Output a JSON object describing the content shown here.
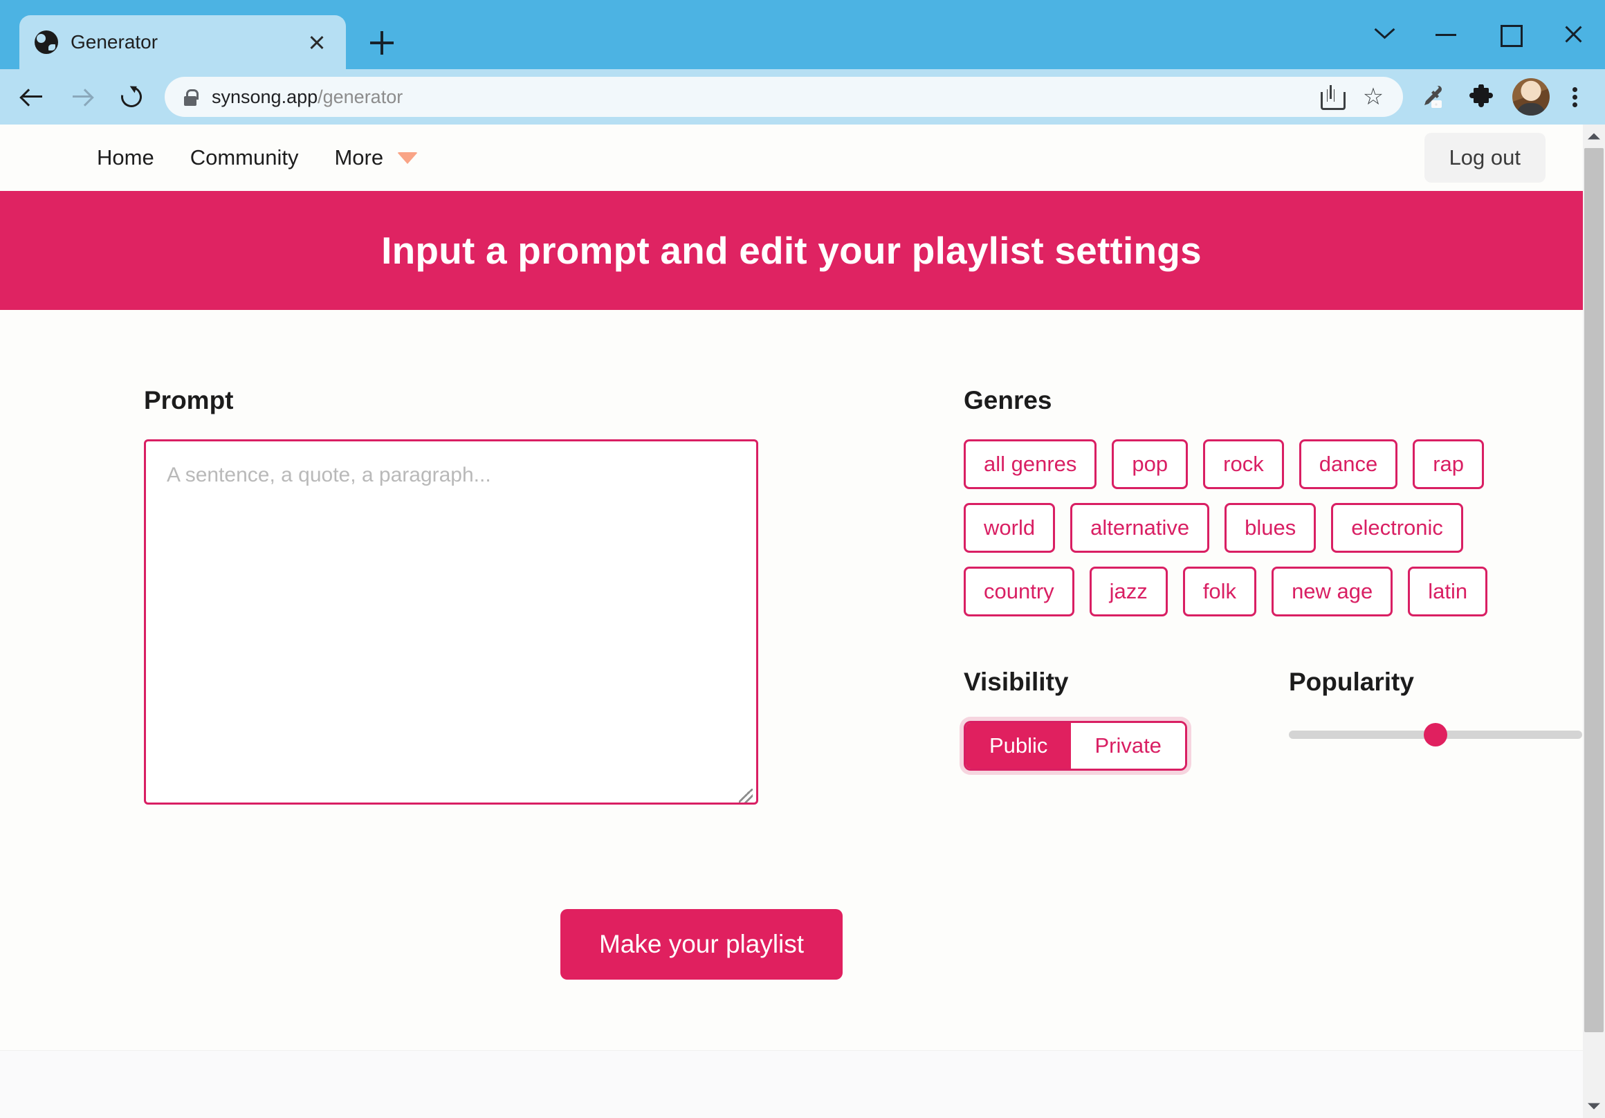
{
  "browser": {
    "tab": {
      "title": "Generator",
      "favicon": "globe-icon"
    },
    "new_tab_label": "+",
    "window_controls": [
      "chevron-down-icon",
      "minimize-icon",
      "maximize-icon",
      "close-icon"
    ],
    "nav": {
      "back": "back-arrow-icon",
      "forward": "forward-arrow-icon",
      "reload": "reload-icon"
    },
    "omnibox": {
      "lock": "lock-icon",
      "url_domain": "synsong.app",
      "url_path": "/generator",
      "url_full": "synsong.app/generator",
      "share": "share-icon",
      "bookmark": "star-icon"
    },
    "toolbar_icons": [
      "eyedropper-icon",
      "extensions-puzzle-icon",
      "avatar",
      "kebab-menu-icon"
    ]
  },
  "site_header": {
    "nav_items": [
      {
        "label": "Home"
      },
      {
        "label": "Community"
      },
      {
        "label": "More"
      }
    ],
    "more_chevron": "chevron-down-icon",
    "logout_label": "Log out"
  },
  "hero": {
    "title": "Input a prompt and edit your playlist settings",
    "bg_color": "#df2362"
  },
  "prompt": {
    "label": "Prompt",
    "value": "",
    "placeholder": "A sentence, a quote, a paragraph..."
  },
  "genres": {
    "label": "Genres",
    "rows": [
      [
        {
          "label": "all genres",
          "selected": false
        },
        {
          "label": "pop",
          "selected": false
        },
        {
          "label": "rock",
          "selected": false
        },
        {
          "label": "dance",
          "selected": false
        },
        {
          "label": "rap",
          "selected": false
        }
      ],
      [
        {
          "label": "world",
          "selected": false
        },
        {
          "label": "alternative",
          "selected": false
        },
        {
          "label": "blues",
          "selected": false
        },
        {
          "label": "electronic",
          "selected": false
        }
      ],
      [
        {
          "label": "country",
          "selected": false
        },
        {
          "label": "jazz",
          "selected": false
        },
        {
          "label": "folk",
          "selected": false
        },
        {
          "label": "new age",
          "selected": false
        },
        {
          "label": "latin",
          "selected": false
        }
      ]
    ]
  },
  "visibility": {
    "label": "Visibility",
    "options": [
      {
        "label": "Public",
        "selected": true
      },
      {
        "label": "Private",
        "selected": false
      }
    ],
    "selected": "Public"
  },
  "popularity": {
    "label": "Popularity",
    "value_percent": 50,
    "min": 0,
    "max": 100
  },
  "submit": {
    "label": "Make your playlist"
  },
  "colors": {
    "accent_pink": "#d91f63",
    "hero_pink": "#df2362",
    "fill_pink": "#e0205f",
    "chevron_peach": "#f9a486",
    "page_bg": "#fdfdfb",
    "browser_blue": "#4cb3e3",
    "toolbar_blue": "#b6dff3"
  }
}
